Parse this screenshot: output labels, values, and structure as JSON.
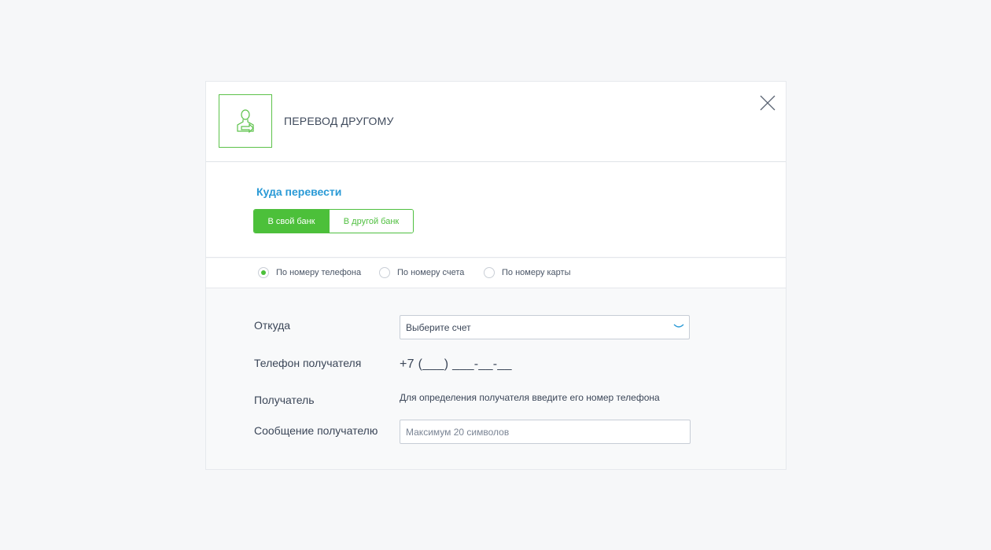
{
  "header": {
    "title": "ПЕРЕВОД ДРУГОМУ",
    "icon": "person-transfer-icon",
    "close_icon": "close-icon"
  },
  "destination": {
    "title": "Куда перевести",
    "options": [
      {
        "label": "В свой банк",
        "selected": true
      },
      {
        "label": "В другой банк",
        "selected": false
      }
    ]
  },
  "method": {
    "options": [
      {
        "label": "По номеру телефона",
        "selected": true
      },
      {
        "label": "По номеру счета",
        "selected": false
      },
      {
        "label": "По номеру карты",
        "selected": false
      }
    ]
  },
  "form": {
    "from_label": "Откуда",
    "from_value": "Выберите счет",
    "phone_label": "Телефон получателя",
    "phone_mask": "+7 (___) ___-__-__",
    "recipient_label": "Получатель",
    "recipient_hint": "Для определения получателя введите его номер телефона",
    "message_label": "Сообщение получателю",
    "message_placeholder": "Максимум 20 символов",
    "message_value": ""
  },
  "colors": {
    "accent_green": "#4cc03a",
    "link_blue": "#2a9ad6",
    "page_bg": "#f6f7f9"
  }
}
